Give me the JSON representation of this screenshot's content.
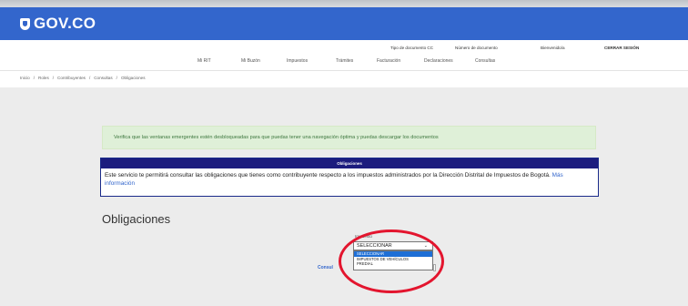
{
  "header": {
    "logo_text": "GOV.CO",
    "brand_color": "#3366cc"
  },
  "userbar": {
    "doc_type": "Tipo de documento CC",
    "doc_number": "Número de documento",
    "welcome": "Bienvenido/a",
    "logout": "CERRAR SESIÓN"
  },
  "nav": {
    "items": [
      "Mi RIT",
      "Mi Buzón",
      "Impuestos",
      "Trámites",
      "Facturación",
      "Declaraciones",
      "Consultas"
    ]
  },
  "breadcrumb": {
    "items": [
      "Inicio",
      "Roles",
      "Contribuyentes",
      "Consultas",
      "Obligaciones"
    ]
  },
  "alert": {
    "text": "Verifica que las ventanas emergentes estén desbloqueadas para que puedas tener una navegación óptima y puedas descargar los documentos"
  },
  "info": {
    "header": "Obligaciones",
    "body": "Este servicio te permitirá consultar las obligaciones que tienes como contribuyente respecto a los impuestos administrados por la Dirección Distrital de Impuestos de Bogotá.",
    "more_link": "Más información"
  },
  "main": {
    "title": "Obligaciones",
    "field_label": "Impuesto",
    "select_value": "SELECCIONAR",
    "options": [
      "SELECCIONAR",
      "IMPUESTOS DE VEHÍCULOS",
      "PREDIAL"
    ],
    "consult_link": "Consul"
  },
  "colors": {
    "alert_bg": "#dff0d8",
    "info_header": "#1c1c7e",
    "highlight_circle": "#e3152e",
    "option_highlight": "#1e6fd6"
  }
}
